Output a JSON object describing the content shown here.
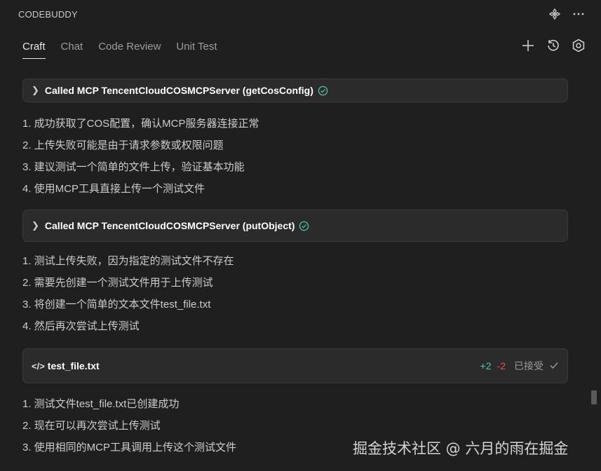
{
  "app": {
    "title": "CODEBUDDY"
  },
  "tabs": [
    {
      "label": "Craft",
      "active": true
    },
    {
      "label": "Chat",
      "active": false
    },
    {
      "label": "Code Review",
      "active": false
    },
    {
      "label": "Unit Test",
      "active": false
    }
  ],
  "icons": {
    "top": [
      "extension-icon",
      "more-icon"
    ],
    "actions": [
      "plus-icon",
      "history-icon",
      "settings-icon"
    ]
  },
  "call1": {
    "label": "Called MCP TencentCloudCOSMCPServer (getCosConfig)"
  },
  "list1": [
    "1. 成功获取了COS配置，确认MCP服务器连接正常",
    "2. 上传失败可能是由于请求参数或权限问题",
    "3. 建议测试一个简单的文件上传，验证基本功能",
    "4. 使用MCP工具直接上传一个测试文件"
  ],
  "call2": {
    "label": "Called MCP TencentCloudCOSMCPServer (putObject)"
  },
  "list2": [
    "1. 测试上传失败，因为指定的测试文件不存在",
    "2. 需要先创建一个测试文件用于上传测试",
    "3. 将创建一个简单的文本文件test_file.txt",
    "4. 然后再次尝试上传测试"
  ],
  "file": {
    "icon": "</>",
    "name": "test_file.txt",
    "added": "+2",
    "removed": "-2",
    "status": "已接受"
  },
  "list3": [
    "1. 测试文件test_file.txt已创建成功",
    "2. 现在可以再次尝试上传测试",
    "3. 使用相同的MCP工具调用上传这个测试文件"
  ],
  "watermark": "掘金技术社区 @ 六月的雨在掘金",
  "colors": {
    "success": "#4ec9b0",
    "added": "#4ec9b0",
    "removed": "#f14c4c",
    "background": "#1f1f1f",
    "card": "#2b2b2b"
  }
}
